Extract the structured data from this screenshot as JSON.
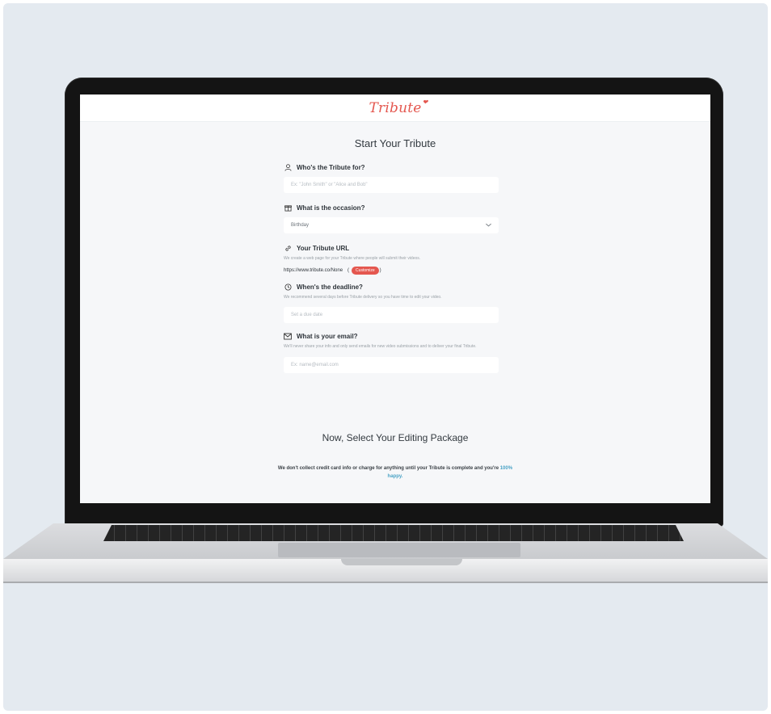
{
  "brand": {
    "logo": "Tribute"
  },
  "form": {
    "title": "Start Your Tribute",
    "recipient": {
      "label": "Who's the Tribute for?",
      "placeholder": "Ex: \"John Smith\" or \"Alice and Bob\""
    },
    "occasion": {
      "label": "What is the occasion?",
      "value": "Birthday"
    },
    "url": {
      "label": "Your Tribute URL",
      "hint": "We create a web page for your Tribute where people will submit their videos.",
      "value": "https://www.tribute.co/None",
      "customize_label": "Customize"
    },
    "deadline": {
      "label": "When's the deadline?",
      "hint": "We recommend several days before Tribute delivery so you have time to edit your video.",
      "placeholder": "Set a due date"
    },
    "email": {
      "label": "What is your email?",
      "hint": "We'll never share your info and only send emails for new video submissions and to deliver your final Tribute.",
      "placeholder": "Ex: name@email.com"
    }
  },
  "package": {
    "title": "Now, Select Your Editing Package",
    "note_main": "We don't collect credit card info or charge for anything until your Tribute is complete and you're",
    "note_highlight": "100% happy."
  },
  "colors": {
    "accent": "#e4574f",
    "link": "#4aa3c6",
    "background": "#e4eaf0"
  },
  "icons": [
    "person-icon",
    "gift-icon",
    "link-icon",
    "clock-icon",
    "envelope-icon",
    "chevron-down-icon"
  ]
}
